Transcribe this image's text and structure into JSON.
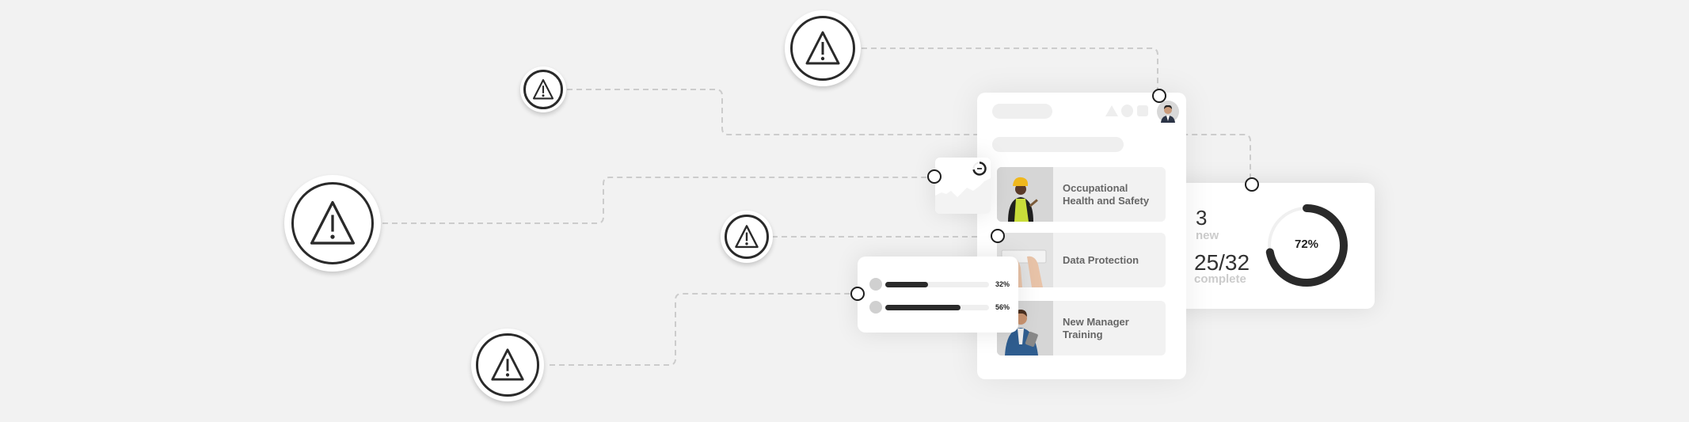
{
  "colors": {
    "background": "#f2f2f2",
    "accent": "#2a2a2a",
    "connector": "#cccccc",
    "muted_text": "#cccccc"
  },
  "alerts": [
    {
      "icon": "warning-triangle-icon"
    },
    {
      "icon": "warning-triangle-icon"
    },
    {
      "icon": "warning-triangle-icon"
    },
    {
      "icon": "warning-triangle-icon"
    },
    {
      "icon": "warning-triangle-icon"
    }
  ],
  "panel": {
    "header_icons": [
      "triangle-shape-icon",
      "circle-shape-icon",
      "square-shape-icon"
    ],
    "avatar": "user-avatar",
    "courses": [
      {
        "title": "Occupational Health and Safety",
        "photo": "worker-with-hard-hat"
      },
      {
        "title": "Data Protection",
        "photo": "hands-on-keyboard"
      },
      {
        "title": "New Manager Training",
        "photo": "man-with-tablet"
      }
    ]
  },
  "stats_card": {
    "new_count": "3",
    "new_label": "new",
    "complete_count": "25/32",
    "complete_label": "complete",
    "progress_label": "72%",
    "progress": 72
  },
  "progress_card": {
    "bars": [
      {
        "label": "32%",
        "value": 32
      },
      {
        "label": "56%",
        "value": 56
      }
    ]
  },
  "mini_card": {
    "progress": 72
  }
}
